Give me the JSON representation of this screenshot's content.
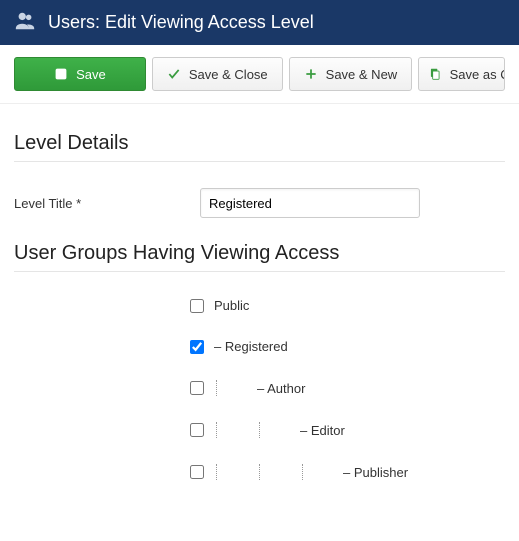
{
  "header": {
    "title": "Users: Edit Viewing Access Level"
  },
  "toolbar": {
    "save": "Save",
    "save_close": "Save & Close",
    "save_new": "Save & New",
    "save_copy": "Save as C"
  },
  "sections": {
    "details": "Level Details",
    "groups": "User Groups Having Viewing Access"
  },
  "fields": {
    "level_title_label": "Level Title *",
    "level_title_value": "Registered"
  },
  "groups": [
    {
      "label": "Public",
      "checked": false,
      "depth": 0
    },
    {
      "label": "– Registered",
      "checked": true,
      "depth": 0
    },
    {
      "label": "– Author",
      "checked": false,
      "depth": 1
    },
    {
      "label": "– Editor",
      "checked": false,
      "depth": 2
    },
    {
      "label": "– Publisher",
      "checked": false,
      "depth": 3
    }
  ]
}
